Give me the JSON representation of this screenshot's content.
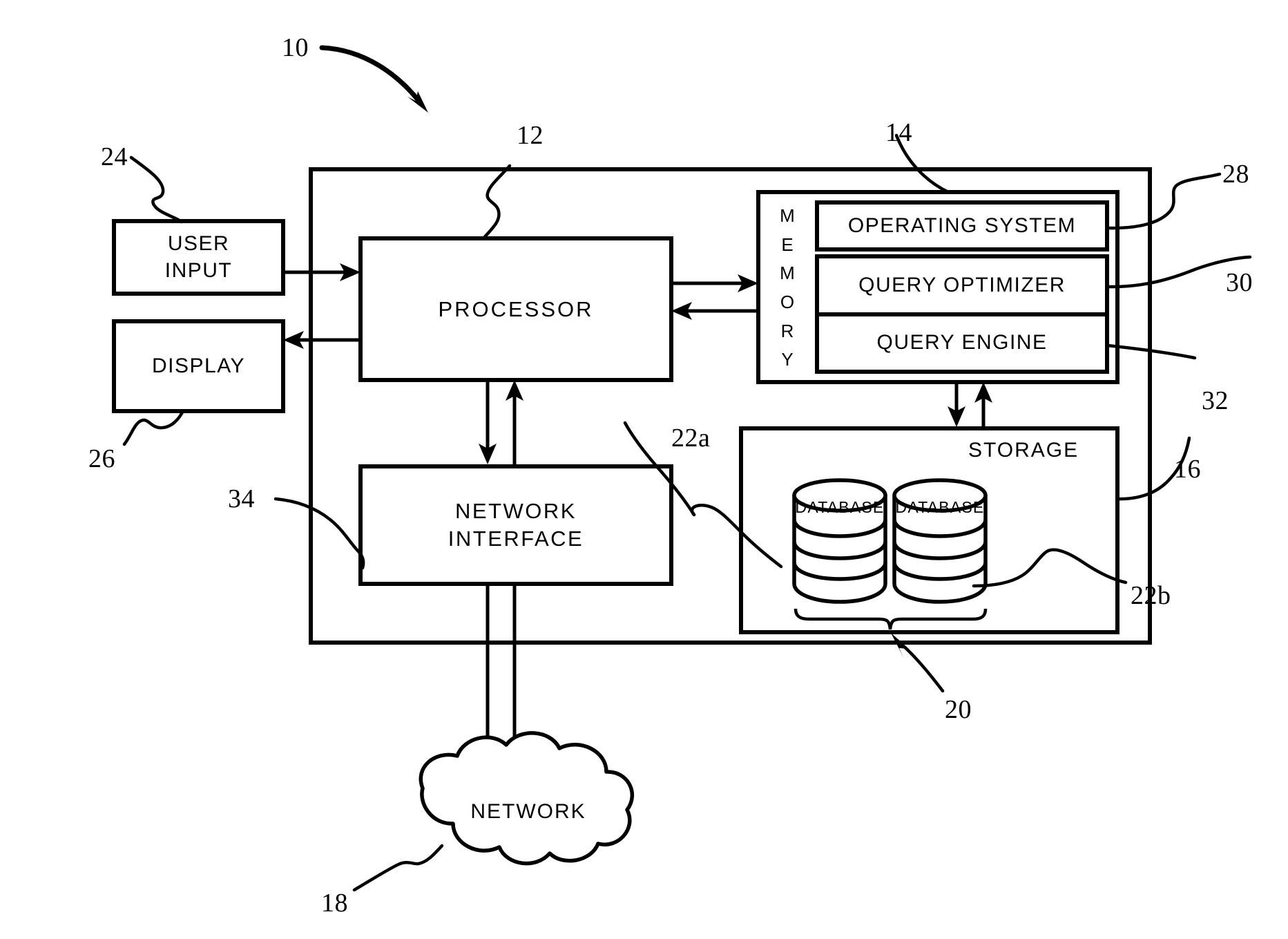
{
  "figure": {
    "title": "Database system block diagram",
    "style": "patent-line-drawing",
    "stroke_color": "#000000",
    "background_color": "#ffffff"
  },
  "blocks": {
    "user_input": "USER\nINPUT",
    "user_input_line1": "USER",
    "user_input_line2": "INPUT",
    "display": "DISPLAY",
    "processor": "PROCESSOR",
    "network_interface_line1": "NETWORK",
    "network_interface_line2": "INTERFACE",
    "memory": "M\nE\nM\nO\nR\nY",
    "memory_letters": [
      "M",
      "E",
      "M",
      "O",
      "R",
      "Y"
    ],
    "operating_system": "OPERATING SYSTEM",
    "query_optimizer": "QUERY OPTIMIZER",
    "query_engine": "QUERY ENGINE",
    "storage": "STORAGE",
    "database_a": "DATABASE",
    "database_b": "DATABASE",
    "network": "NETWORK"
  },
  "reference_numerals": {
    "system": "10",
    "processor": "12",
    "memory": "14",
    "storage": "16",
    "network": "18",
    "databases_group": "20",
    "database_a": "22a",
    "database_b": "22b",
    "user_input": "24",
    "display": "26",
    "operating_system": "28",
    "query_optimizer": "30",
    "query_engine": "32",
    "network_interface": "34"
  }
}
